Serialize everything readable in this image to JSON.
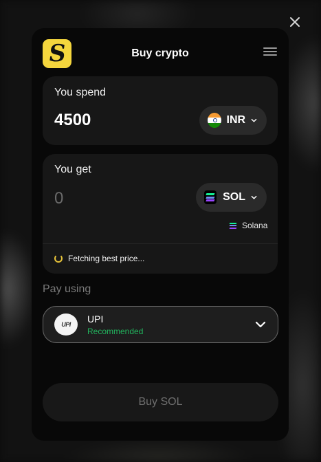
{
  "header": {
    "logo_glyph": "S",
    "title": "Buy crypto"
  },
  "spend": {
    "label": "You spend",
    "amount": "4500",
    "currency": "INR",
    "flag": "india-flag-icon"
  },
  "get": {
    "label": "You get",
    "amount": "0",
    "currency": "SOL",
    "network": "Solana",
    "status": "Fetching best price..."
  },
  "payment": {
    "label": "Pay using",
    "method": "UPI",
    "method_logo_text": "UPI",
    "tag": "Recommended"
  },
  "buy_button": {
    "label": "Buy SOL"
  },
  "colors": {
    "brand_yellow": "#f5d63d",
    "recommended_green": "#22b45e",
    "spinner_yellow": "#e8c43a",
    "sol_gradient": [
      "#9945ff",
      "#14f195"
    ]
  }
}
